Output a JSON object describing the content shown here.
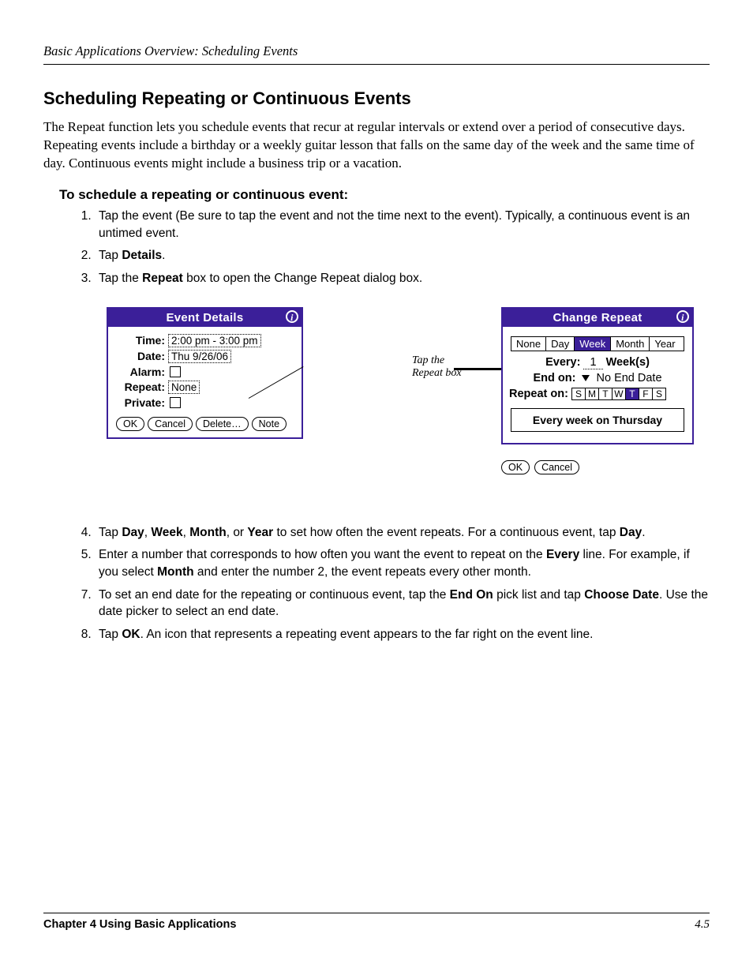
{
  "header": {
    "running": "Basic Applications Overview: Scheduling Events"
  },
  "section": {
    "title": "Scheduling Repeating or Continuous Events",
    "intro": "The Repeat function lets you schedule events that recur at regular intervals or extend over a period of consecutive days. Repeating events include a birthday or a weekly guitar lesson that falls on the same day of the week and the same time of day. Continuous events might include a business trip or a vacation.",
    "subhead": "To schedule a repeating or continuous event:"
  },
  "steps": {
    "s1": "Tap the event (Be sure to tap the event and not the time next to the event). Typically, a continuous event is an untimed event.",
    "s2_a": "Tap ",
    "s2_b": "Details",
    "s2_c": ".",
    "s3_a": "Tap the ",
    "s3_b": "Repeat",
    "s3_c": " box to open the Change Repeat dialog box.",
    "s4_a": "Tap ",
    "s4_day": "Day",
    "s4_sep": ", ",
    "s4_week": "Week",
    "s4_month": "Month",
    "s4_or": ", or ",
    "s4_year": "Year",
    "s4_b": " to set how often the event repeats. For a continuous event, tap ",
    "s4_day2": "Day",
    "s4_end": ".",
    "s5_a": "Enter a number that corresponds to how often you want the event to repeat on the ",
    "s5_every": "Every",
    "s5_b": " line. For example, if you select ",
    "s5_month": "Month",
    "s5_c": " and enter the number 2, the event repeats every other month.",
    "s7_a": "To set an end date for the repeating or continuous event, tap the ",
    "s7_endon": "End On",
    "s7_b": " pick list and tap ",
    "s7_choose": "Choose Date",
    "s7_c": ". Use the date picker to select an end date.",
    "s8_a": "Tap ",
    "s8_ok": "OK",
    "s8_b": ". An icon that represents a repeating event appears to the far right on the event line."
  },
  "dialog1": {
    "title": "Event Details",
    "time_label": "Time:",
    "time_value": "2:00 pm - 3:00 pm",
    "date_label": "Date:",
    "date_value": "Thu 9/26/06",
    "alarm_label": "Alarm:",
    "repeat_label": "Repeat:",
    "repeat_value": "None",
    "private_label": "Private:",
    "ok": "OK",
    "cancel": "Cancel",
    "delete": "Delete…",
    "note": "Note"
  },
  "callout": {
    "line1": "Tap the",
    "line2": "Repeat box"
  },
  "dialog2": {
    "title": "Change Repeat",
    "tabs": {
      "none": "None",
      "day": "Day",
      "week": "Week",
      "month": "Month",
      "year": "Year"
    },
    "every_label": "Every:",
    "every_value": "1",
    "every_unit": "Week(s)",
    "endon_label": "End on:",
    "endon_value": "No End Date",
    "repeaton_label": "Repeat on:",
    "days": {
      "S1": "S",
      "M": "M",
      "T1": "T",
      "W": "W",
      "T2": "T",
      "F": "F",
      "S2": "S"
    },
    "summary": "Every week on Thursday",
    "ok": "OK",
    "cancel": "Cancel"
  },
  "footer": {
    "left": "Chapter 4 Using Basic Applications",
    "right": "4.5"
  }
}
